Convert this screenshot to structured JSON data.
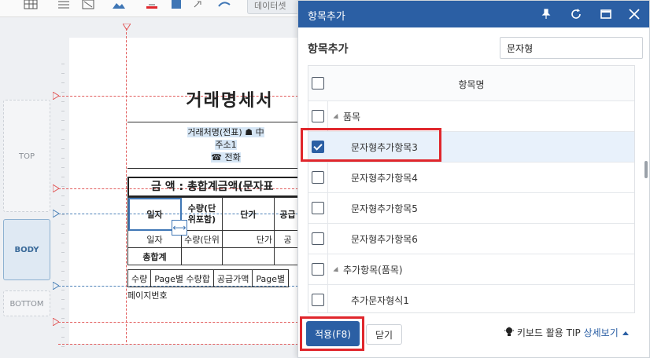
{
  "toolbar": {
    "partial_button": "데이터셋"
  },
  "canvas": {
    "bands": {
      "top": "TOP",
      "body": "BODY",
      "bottom": "BOTTOM"
    },
    "doc_title": "거래명세서",
    "info_lines": [
      "거래처명(전표) ☗ 中",
      "주소1",
      "☎ 전화"
    ],
    "amount_text": "금   액 : 총합계금액(문자표",
    "table_headers": [
      "일자",
      "수량(단\n위포함)",
      "단가",
      "공급"
    ],
    "table_row": [
      "일자",
      "수량(단위",
      "단가",
      "공"
    ],
    "total_label": "총합계",
    "footer_cells": [
      "수량",
      "Page별 수량합",
      "공급가액",
      "Page별"
    ],
    "page_number": "페이지번호",
    "resize_symbol": "⟷"
  },
  "dialog": {
    "title": "항목추가",
    "subtitle": "항목추가",
    "search_value": "문자형",
    "column_header": "항목명",
    "rows": [
      {
        "label": "품목",
        "group": true,
        "checked": false
      },
      {
        "label": "문자형추가항목3",
        "group": false,
        "checked": true
      },
      {
        "label": "문자형추가항목4",
        "group": false,
        "checked": false
      },
      {
        "label": "문자형추가항목5",
        "group": false,
        "checked": false
      },
      {
        "label": "문자형추가항목6",
        "group": false,
        "checked": false
      },
      {
        "label": "추가항목(품목)",
        "group": true,
        "checked": false
      },
      {
        "label": "추가문자형식1",
        "group": false,
        "checked": false
      }
    ],
    "apply_label": "적용(F8)",
    "close_label": "닫기",
    "tip_label": "키보드 활용 TIP",
    "tip_link": "상세보기"
  },
  "colors": {
    "accent": "#2b5fa4",
    "highlight": "#e0262c"
  }
}
